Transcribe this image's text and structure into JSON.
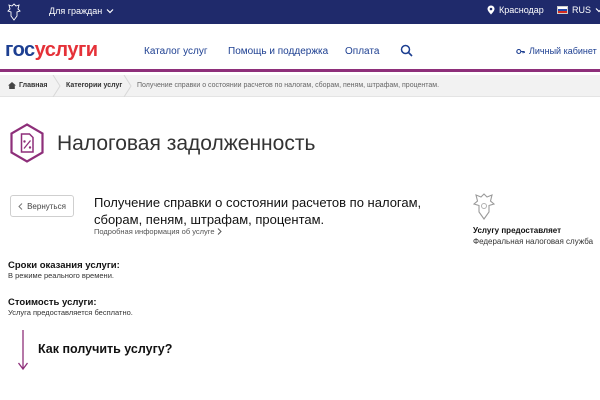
{
  "topbar": {
    "for_citizens": "Для граждан",
    "region": "Краснодар",
    "language": "RUS"
  },
  "header": {
    "logo_gos": "гос",
    "logo_uslugi": "услуги",
    "nav": [
      "Каталог услуг",
      "Помощь и поддержка",
      "Оплата"
    ],
    "cabinet": "Личный кабинет"
  },
  "breadcrumb": {
    "items": [
      "Главная",
      "Категории услуг",
      "Получение справки о состоянии расчетов по налогам, сборам, пеням, штрафам, процентам."
    ]
  },
  "page": {
    "title": "Налоговая задолженность",
    "back": "Вернуться",
    "service_title": "Получение справки о состоянии расчетов по налогам, сборам, пеням, штрафам, процентам.",
    "more_info": "Подробная информация об услуге",
    "provider_label": "Услугу предоставляет",
    "provider_name": "Федеральная налоговая служба",
    "terms_title": "Сроки оказания услуги:",
    "terms_text": "В режиме реального времени.",
    "cost_title": "Стоимость услуги:",
    "cost_text": "Услуга предоставляется бесплатно.",
    "how_title": "Как получить услугу?"
  },
  "colors": {
    "topbar": "#1f2a6b",
    "brand_blue": "#1d3f91",
    "brand_red": "#e53138",
    "accent_purple": "#8e2f7a"
  }
}
